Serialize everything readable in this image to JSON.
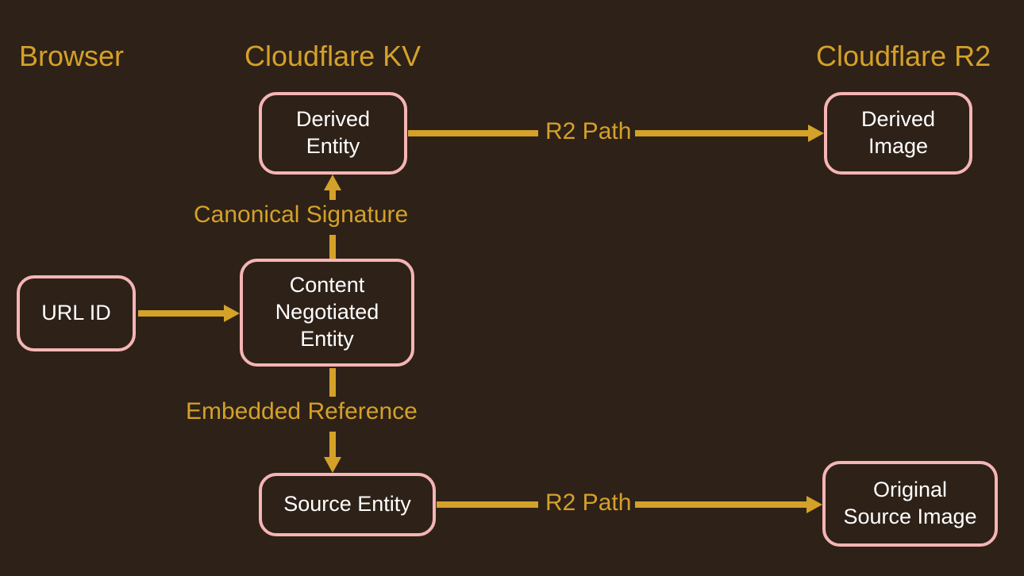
{
  "headers": {
    "browser": "Browser",
    "kv": "Cloudflare KV",
    "r2": "Cloudflare R2"
  },
  "nodes": {
    "url_id": "URL ID",
    "derived_entity": "Derived\nEntity",
    "content_negotiated": "Content\nNegotiated\nEntity",
    "source_entity": "Source Entity",
    "derived_image": "Derived\nImage",
    "original_source_image": "Original\nSource Image"
  },
  "edges": {
    "canonical_signature": "Canonical Signature",
    "embedded_reference": "Embedded Reference",
    "r2_path_top": "R2 Path",
    "r2_path_bottom": "R2 Path"
  }
}
